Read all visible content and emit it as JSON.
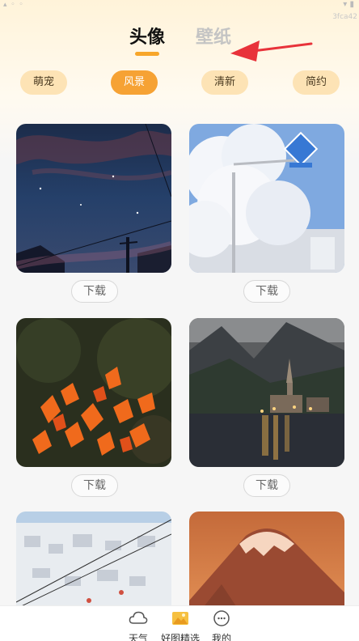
{
  "status": {
    "build_tag": "3fca42"
  },
  "tabs": [
    {
      "label": "头像",
      "active": true
    },
    {
      "label": "壁纸",
      "active": false
    }
  ],
  "categories": [
    {
      "label": "萌宠",
      "active": false
    },
    {
      "label": "风景",
      "active": true
    },
    {
      "label": "清新",
      "active": false
    },
    {
      "label": "简约",
      "active": false
    }
  ],
  "cards": [
    {
      "image": "night-sky-powerlines",
      "button": "下载"
    },
    {
      "image": "snow-tree-crosswalk-sign",
      "button": "下载"
    },
    {
      "image": "orange-autumn-leaves",
      "button": "下载"
    },
    {
      "image": "lakeside-village-church",
      "button": "下载"
    },
    {
      "image": "snowy-city-aerial",
      "button": ""
    },
    {
      "image": "sunset-mountain-peak",
      "button": ""
    }
  ],
  "bottom_nav": [
    {
      "label": "天气",
      "icon": "cloud-icon",
      "active": false
    },
    {
      "label": "好图精选",
      "icon": "picture-icon",
      "active": true
    },
    {
      "label": "我的",
      "icon": "profile-icon",
      "active": false
    }
  ],
  "colors": {
    "accent": "#f6a234",
    "chip_bg": "#fde3b5",
    "annotation_arrow": "#e8323a"
  }
}
